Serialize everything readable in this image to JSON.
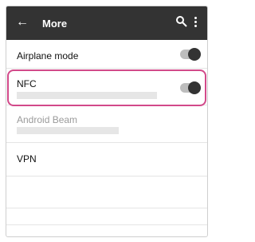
{
  "appbar": {
    "back_icon": "arrow-left-icon",
    "title": "More",
    "search_icon": "search-icon",
    "menu_icon": "more-vert-icon",
    "background": "#333333"
  },
  "settings": [
    {
      "label": "Airplane mode",
      "toggle": "off",
      "enabled": true
    },
    {
      "label": "NFC",
      "toggle": "off",
      "enabled": true,
      "highlighted": true
    },
    {
      "label": "Android Beam",
      "enabled": false
    },
    {
      "label": "VPN",
      "enabled": true
    }
  ],
  "colors": {
    "highlight": "#d24a8a",
    "disabled_text": "#9a9a9a"
  }
}
